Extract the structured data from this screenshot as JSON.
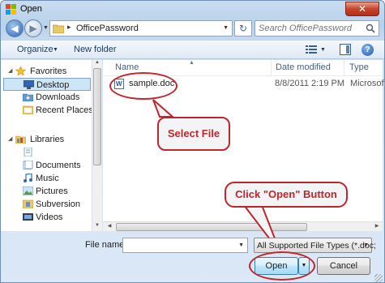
{
  "window": {
    "title": "Open",
    "close_glyph": "✕"
  },
  "nav": {
    "back_glyph": "◀",
    "forward_glyph": "▶",
    "path_separator": "▸",
    "path": "OfficePassword",
    "refresh_glyph": "↻",
    "search_placeholder": "Search OfficePassword"
  },
  "toolbar": {
    "organize_label": "Organize",
    "new_folder_label": "New folder",
    "help_glyph": "?"
  },
  "sidebar": {
    "favorites_label": "Favorites",
    "favorites": [
      {
        "label": "Desktop",
        "icon": "desktop-icon"
      },
      {
        "label": "Downloads",
        "icon": "downloads-icon"
      },
      {
        "label": "Recent Places",
        "icon": "recent-places-icon"
      }
    ],
    "libraries_label": "Libraries",
    "libraries": [
      {
        "label": "Documents",
        "icon": "documents-icon"
      },
      {
        "label": "Music",
        "icon": "music-icon"
      },
      {
        "label": "Pictures",
        "icon": "pictures-icon"
      },
      {
        "label": "Subversion",
        "icon": "subversion-icon"
      },
      {
        "label": "Videos",
        "icon": "videos-icon"
      }
    ]
  },
  "columns": {
    "name": "Name",
    "date_modified": "Date modified",
    "type": "Type"
  },
  "files": [
    {
      "name": "sample.doc",
      "date_modified": "8/8/2011 2:19 PM",
      "type": "Microsoft"
    }
  ],
  "annotations": {
    "select_file": "Select File",
    "click_open": "Click \"Open\" Button"
  },
  "bottom": {
    "file_name_label": "File name:",
    "file_name_value": "",
    "file_type_value": "All Supported File Types (*.doc;",
    "open_label": "Open",
    "cancel_label": "Cancel"
  },
  "colors": {
    "annotation_red": "#c0262c",
    "selection_blue": "#cde6f7"
  }
}
